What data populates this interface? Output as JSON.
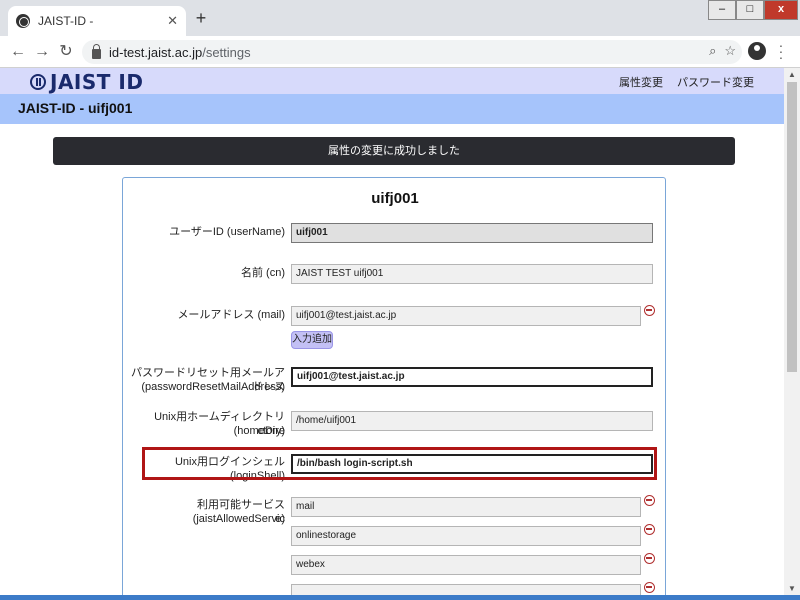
{
  "browser": {
    "tab_title": "JAIST-ID -",
    "tab_close": "✕",
    "new_tab": "+",
    "url_host": "id-test.jaist.ac.jp",
    "url_path": "/settings",
    "back": "←",
    "forward": "→",
    "reload": "↻",
    "zoom_icon": "⌕",
    "star_icon": "☆"
  },
  "window": {
    "minimize": "–",
    "maximize": "□",
    "close": "x"
  },
  "site": {
    "logo_text": "JAIST ID",
    "nav": [
      "属性変更",
      "パスワード変更"
    ],
    "page_heading": "JAIST-ID - uifj001"
  },
  "flash_message": "属性の変更に成功しました",
  "form": {
    "title": "uifj001",
    "username_label": "ユーザーID (userName)",
    "username_value": "uifj001",
    "cn_label": "名前 (cn)",
    "cn_value": "JAIST TEST uifj001",
    "mail_label": "メールアドレス (mail)",
    "mail_value": "uifj001@test.jaist.ac.jp",
    "add_input_label": "入力追加",
    "reset_mail_label_1": "パスワードリセット用メールアドレス",
    "reset_mail_label_2": "(passwordResetMailAddress)",
    "reset_mail_value": "uifj001@test.jaist.ac.jp",
    "home_label_1": "Unix用ホームディレクトリ (homeDire",
    "home_label_2": "ctory)",
    "home_value": "/home/uifj001",
    "shell_label": "Unix用ログインシェル (loginShell)",
    "shell_value": "/bin/bash login-script.sh",
    "service_label_1": "利用可能サービス (jaistAllowedServic",
    "service_label_2": "e)",
    "services": [
      "mail",
      "onlinestorage",
      "webex",
      ""
    ]
  }
}
